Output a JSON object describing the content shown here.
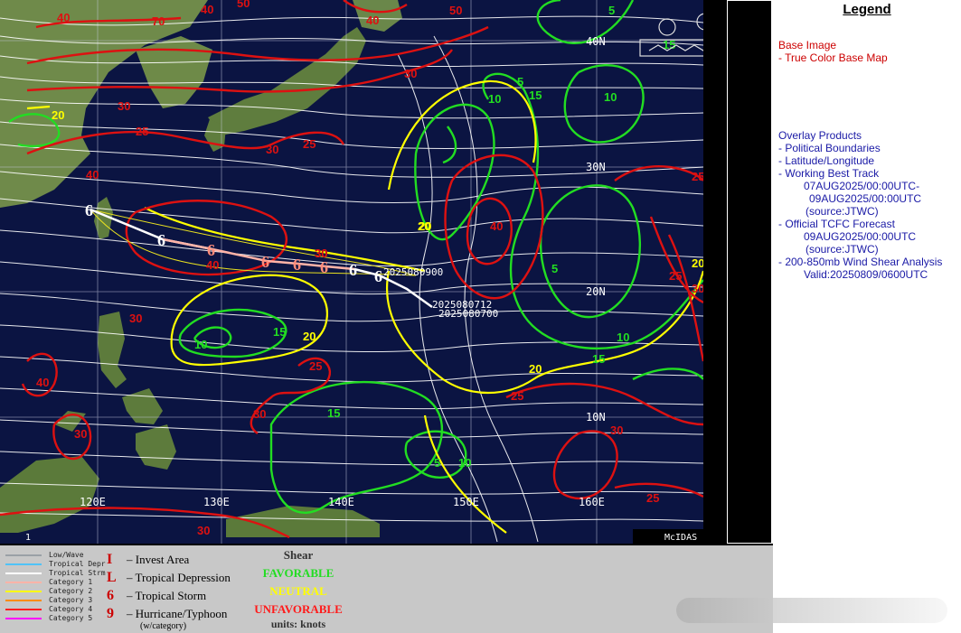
{
  "legend": {
    "title": "Legend",
    "base_image_heading": "Base Image",
    "base_image_item": "-  True Color Base Map",
    "overlay_heading": "Overlay Products",
    "overlay_items": {
      "political": "-  Political Boundaries",
      "latlon": "-  Latitude/Longitude",
      "best_track": "-  Working Best Track",
      "best_track_l1": "07AUG2025/00:00UTC-",
      "best_track_l2": "09AUG2025/00:00UTC",
      "best_track_l3": "(source:JTWC)",
      "forecast": "-  Official TCFC Forecast",
      "forecast_l1": "09AUG2025/00:00UTC",
      "forecast_l2": "(source:JTWC)",
      "shear": "-  200-850mb Wind Shear Analysis",
      "shear_valid": "Valid:20250809/0600UTC"
    }
  },
  "map": {
    "lat_labels": [
      "40N",
      "30N",
      "20N",
      "10N"
    ],
    "lon_labels": [
      "120E",
      "130E",
      "140E",
      "150E",
      "160E"
    ],
    "track_labels": [
      "2025080900",
      "2025080712",
      "2025080700"
    ],
    "corner_number": "1",
    "credit": "McIDAS",
    "contour_values": {
      "favorable": [
        "5",
        "10",
        "15",
        "5",
        "10",
        "15",
        "10",
        "15",
        "5",
        "10",
        "15",
        "5",
        "10",
        "15"
      ],
      "neutral": [
        "20",
        "20",
        "20",
        "20",
        "20",
        "20"
      ],
      "unfavorable": [
        "40",
        "70",
        "40",
        "50",
        "40",
        "50",
        "30",
        "25",
        "30",
        "25",
        "30",
        "25",
        "40",
        "40",
        "40",
        "30",
        "25",
        "30",
        "25",
        "25",
        "30",
        "25",
        "30",
        "30",
        "40",
        "30",
        "30",
        "30"
      ]
    }
  },
  "key": {
    "line_types": [
      {
        "label": "Low/Wave",
        "color": "#9aa0a6"
      },
      {
        "label": "Tropical Depr",
        "color": "#4fc3f7"
      },
      {
        "label": "Tropical Strm",
        "color": "#ffffff"
      },
      {
        "label": "Category 1",
        "color": "#ffb3a7"
      },
      {
        "label": "Category 2",
        "color": "#ffff00"
      },
      {
        "label": "Category 3",
        "color": "#ff8c00"
      },
      {
        "label": "Category 4",
        "color": "#ff2020"
      },
      {
        "label": "Category 5",
        "color": "#ff00ff"
      }
    ],
    "symbols": [
      {
        "glyph": "I",
        "label": "Invest Area"
      },
      {
        "glyph": "L",
        "label": "Tropical Depression"
      },
      {
        "glyph": "6",
        "label": "Tropical Storm"
      },
      {
        "glyph": "9",
        "label": "Hurricane/Typhoon"
      }
    ],
    "symbol_note": "(w/category)",
    "shear": {
      "title": "Shear",
      "favorable": "FAVORABLE",
      "neutral": "NEUTRAL",
      "unfavorable": "UNFAVORABLE",
      "units": "units: knots"
    }
  },
  "colors": {
    "ocean": "#0b1442",
    "favorable": "#22dd22",
    "neutral": "#ffff00",
    "unfavorable": "#dd1111",
    "streamline": "#ffffff",
    "legend_red": "#cc0000",
    "legend_blue": "#1a1aa6"
  }
}
